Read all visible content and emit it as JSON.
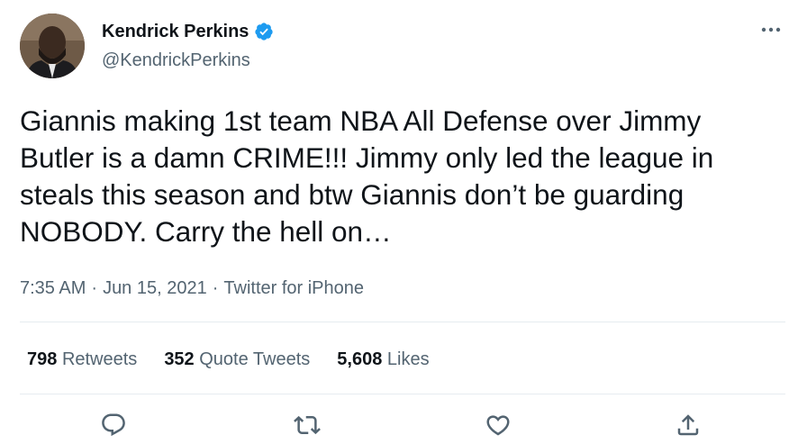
{
  "author": {
    "display_name": "Kendrick Perkins",
    "handle": "@KendrickPerkins",
    "verified": true
  },
  "tweet": {
    "text": "Giannis making 1st team NBA All Defense over Jimmy\nButler is a damn CRIME!!! Jimmy only led the league in\nsteals this season and btw Giannis don’t be guarding\nNOBODY. Carry the hell on…",
    "time": "7:35 AM",
    "separator": "·",
    "date": "Jun 15, 2021",
    "source": "Twitter for iPhone"
  },
  "stats": {
    "retweets": {
      "count": "798",
      "label": "Retweets"
    },
    "quote_tweets": {
      "count": "352",
      "label": "Quote Tweets"
    },
    "likes": {
      "count": "5,608",
      "label": "Likes"
    }
  },
  "colors": {
    "verified_badge": "#1d9bf0",
    "secondary_text": "#536471",
    "primary_text": "#0f1419",
    "divider": "#e6ecf0"
  },
  "icons": {
    "more": "more-icon",
    "reply": "reply-icon",
    "retweet": "retweet-icon",
    "like": "like-icon",
    "share": "share-icon"
  }
}
